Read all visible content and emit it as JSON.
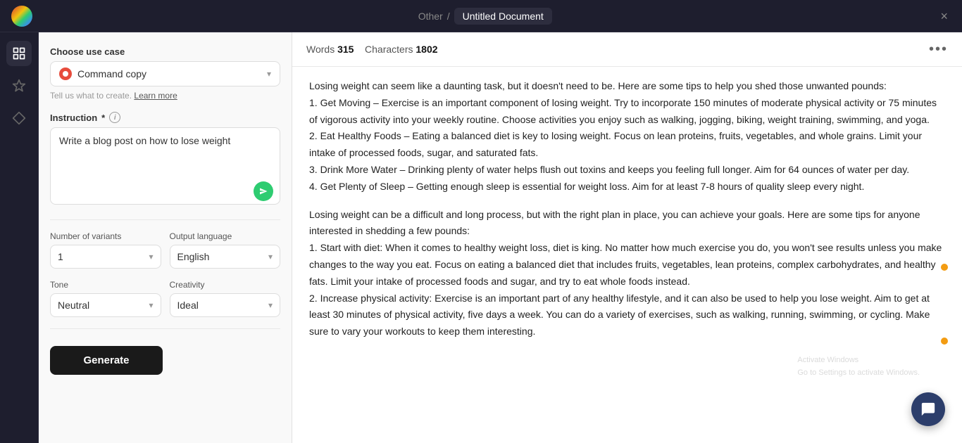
{
  "topbar": {
    "breadcrumb_other": "Other",
    "breadcrumb_separator": "/",
    "document_name": "Untitled Document",
    "close_label": "×"
  },
  "left_panel": {
    "use_case_section": {
      "label": "Choose use case",
      "selected": "Command copy",
      "help_text": "Tell us what to create.",
      "learn_more": "Learn more"
    },
    "instruction_section": {
      "label": "Instruction",
      "required": "*",
      "placeholder": "Write a blog post on how to lose weight",
      "value": "Write a blog post on how to lose weight"
    },
    "variants_section": {
      "label": "Number of variants",
      "value": "1"
    },
    "output_language_section": {
      "label": "Output language",
      "value": "English"
    },
    "tone_section": {
      "label": "Tone",
      "value": "Neutral"
    },
    "creativity_section": {
      "label": "Creativity",
      "value": "Ideal"
    },
    "generate_button": "Generate"
  },
  "content": {
    "word_count_label": "Words",
    "word_count_value": "315",
    "char_count_label": "Characters",
    "char_count_value": "1802",
    "paragraphs": [
      "Losing weight can seem like a daunting task, but it doesn't need to be. Here are some tips to help you shed those unwanted pounds:\n1. Get Moving – Exercise is an important component of losing weight. Try to incorporate 150 minutes of moderate physical activity or 75 minutes of vigorous activity into your weekly routine. Choose activities you enjoy such as walking, jogging, biking, weight training, swimming, and yoga.\n2. Eat Healthy Foods – Eating a balanced diet is key to losing weight. Focus on lean proteins, fruits, vegetables, and whole grains. Limit your intake of processed foods, sugar, and saturated fats.\n3. Drink More Water – Drinking plenty of water helps flush out toxins and keeps you feeling full longer. Aim for 64 ounces of water per day.\n4. Get Plenty of Sleep – Getting enough sleep is essential for weight loss. Aim for at least 7-8 hours of quality sleep every night.",
      "Losing weight can be a difficult and long process, but with the right plan in place, you can achieve your goals. Here are some tips for anyone interested in shedding a few pounds:\n1. Start with diet: When it comes to healthy weight loss, diet is king. No matter how much exercise you do, you won't see results unless you make changes to the way you eat. Focus on eating a balanced diet that includes fruits, vegetables, lean proteins, complex carbohydrates, and healthy fats. Limit your intake of processed foods and sugar, and try to eat whole foods instead.\n2. Increase physical activity: Exercise is an important part of any healthy lifestyle, and it can also be used to help you lose weight. Aim to get at least 30 minutes of physical activity, five days a week. You can do a variety of exercises, such as walking, running, swimming, or cycling. Make sure to vary your workouts to keep them interesting."
    ]
  },
  "icons": {
    "sidebar_blocks": "⊞",
    "sidebar_sparkle": "✦",
    "sidebar_diamond": "◇"
  }
}
